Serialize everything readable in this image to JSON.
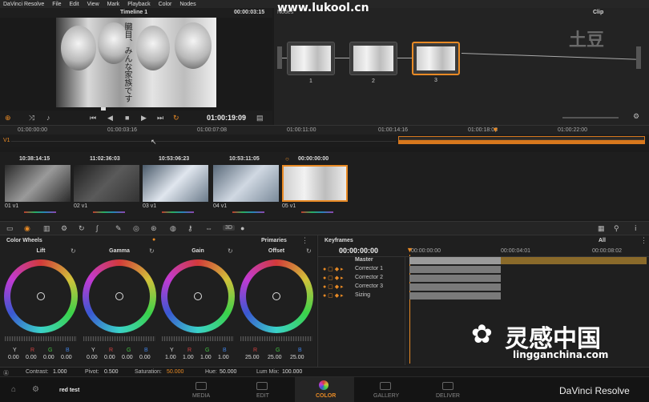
{
  "menu": [
    "DaVinci Resolve",
    "File",
    "Edit",
    "View",
    "Mark",
    "Playback",
    "Color",
    "Nodes"
  ],
  "viewer": {
    "title": "Timeline 1",
    "timecode": "00:00:03:15",
    "overlay_text": "臓目、みんな家族です",
    "transport_timecode": "01:00:19:09"
  },
  "nodes": {
    "header_left": "Nodes",
    "header_right": "Clip",
    "items": [
      {
        "num": "1"
      },
      {
        "num": "2"
      },
      {
        "num": "3"
      }
    ],
    "logo": "土豆"
  },
  "watermark_top": "www.lukool.cn",
  "timeline_ruler": [
    "01:00:00:00",
    "01:00:03:16",
    "01:00:07:08",
    "01:00:11:00",
    "01:00:14:16",
    "01:00:18:08",
    "01:00:22:00"
  ],
  "track_label": "V1",
  "clips": [
    {
      "tc": "10:38:14:15",
      "label": "01  v1"
    },
    {
      "tc": "11:02:36:03",
      "label": "02  v1"
    },
    {
      "tc": "10:53:06:23",
      "label": "03  v1"
    },
    {
      "tc": "10:53:11:05",
      "label": "04  v1"
    },
    {
      "tc": "00:00:00:00",
      "label": "05  v1"
    }
  ],
  "toolbar": {
    "label_3d": "3D"
  },
  "color_wheels": {
    "title": "Color Wheels",
    "mode": "Primaries",
    "wheels": [
      {
        "name": "Lift",
        "y": "0.00",
        "r": "0.00",
        "g": "0.00",
        "b": "0.00"
      },
      {
        "name": "Gamma",
        "y": "0.00",
        "r": "0.00",
        "g": "0.00",
        "b": "0.00"
      },
      {
        "name": "Gain",
        "y": "1.00",
        "r": "1.00",
        "g": "1.00",
        "b": "1.00"
      },
      {
        "name": "Offset",
        "y": "",
        "r": "25.00",
        "g": "25.00",
        "b": "25.00"
      }
    ],
    "channel_labels": {
      "y": "Y",
      "r": "R",
      "g": "G",
      "b": "B"
    }
  },
  "keyframes": {
    "title": "Keyframes",
    "filter": "All",
    "timecode": "00:00:00:00",
    "ruler": [
      "00:00:00:00",
      "00:00:04:01",
      "00:00:08:02"
    ],
    "rows": [
      "Master",
      "Corrector 1",
      "Corrector 2",
      "Corrector 3",
      "Sizing"
    ]
  },
  "status": {
    "contrast_label": "Contrast:",
    "contrast": "1.000",
    "pivot_label": "Pivot:",
    "pivot": "0.500",
    "saturation_label": "Saturation:",
    "saturation": "50.000",
    "hue_label": "Hue:",
    "hue": "50.000",
    "lummix_label": "Lum Mix:",
    "lummix": "100.000"
  },
  "bottom": {
    "project": "red test",
    "tabs": [
      "MEDIA",
      "EDIT",
      "COLOR",
      "GALLERY",
      "DELIVER"
    ],
    "brand": "DaVinci Resolve",
    "watermark_cn": "灵感中国",
    "watermark_url": "lingganchina.com"
  },
  "colors": {
    "accent": "#e88a25",
    "saturation_value": "#e88a25"
  }
}
